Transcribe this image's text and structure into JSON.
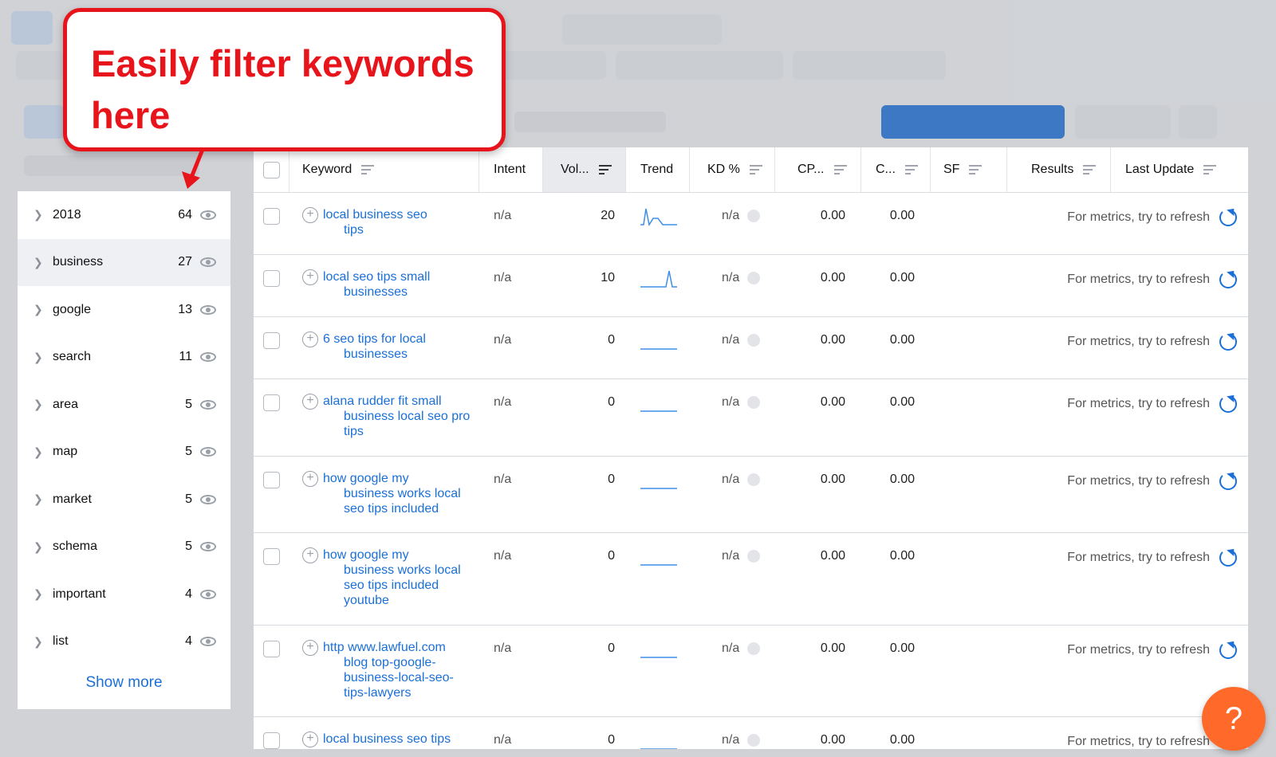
{
  "colors": {
    "accent": "#1a6fd8",
    "callout_red": "#e8141b",
    "help_orange": "#ff6a2b"
  },
  "callout": {
    "line1": "Easily filter keywords",
    "line2": "here"
  },
  "sidebar": {
    "items": [
      {
        "label": "2018",
        "count": "64"
      },
      {
        "label": "business",
        "count": "27",
        "active": true
      },
      {
        "label": "google",
        "count": "13"
      },
      {
        "label": "search",
        "count": "11"
      },
      {
        "label": "area",
        "count": "5"
      },
      {
        "label": "map",
        "count": "5"
      },
      {
        "label": "market",
        "count": "5"
      },
      {
        "label": "schema",
        "count": "5"
      },
      {
        "label": "important",
        "count": "4"
      },
      {
        "label": "list",
        "count": "4"
      }
    ],
    "show_more": "Show more"
  },
  "table": {
    "headers": {
      "keyword": "Keyword",
      "intent": "Intent",
      "volume": "Vol...",
      "trend": "Trend",
      "kd": "KD %",
      "cpc": "CP...",
      "com": "C...",
      "sf": "SF",
      "results": "Results",
      "last_update": "Last Update"
    },
    "rows": [
      {
        "keyword_lines": [
          "local business seo",
          "tips"
        ],
        "intent": "n/a",
        "volume": "20",
        "kd": "n/a",
        "cpc": "0.00",
        "com": "0.00",
        "last_update": "For metrics, try to refresh",
        "trend_shape": "spike-double"
      },
      {
        "keyword_lines": [
          "local seo tips small",
          "businesses"
        ],
        "intent": "n/a",
        "volume": "10",
        "kd": "n/a",
        "cpc": "0.00",
        "com": "0.00",
        "last_update": "For metrics, try to refresh",
        "trend_shape": "spike-single"
      },
      {
        "keyword_lines": [
          "6 seo tips for local",
          "businesses"
        ],
        "intent": "n/a",
        "volume": "0",
        "kd": "n/a",
        "cpc": "0.00",
        "com": "0.00",
        "last_update": "For metrics, try to refresh",
        "trend_shape": "flat"
      },
      {
        "keyword_lines": [
          "alana rudder fit small",
          "business local seo pro",
          "tips"
        ],
        "intent": "n/a",
        "volume": "0",
        "kd": "n/a",
        "cpc": "0.00",
        "com": "0.00",
        "last_update": "For metrics, try to refresh",
        "trend_shape": "flat"
      },
      {
        "keyword_lines": [
          "how google my",
          "business works local",
          "seo tips included"
        ],
        "intent": "n/a",
        "volume": "0",
        "kd": "n/a",
        "cpc": "0.00",
        "com": "0.00",
        "last_update": "For metrics, try to refresh",
        "trend_shape": "flat"
      },
      {
        "keyword_lines": [
          "how google my",
          "business works local",
          "seo tips included",
          "youtube"
        ],
        "intent": "n/a",
        "volume": "0",
        "kd": "n/a",
        "cpc": "0.00",
        "com": "0.00",
        "last_update": "For metrics, try to refresh",
        "trend_shape": "flat"
      },
      {
        "keyword_lines": [
          "http www.lawfuel.com",
          "blog top-google-",
          "business-local-seo-",
          "tips-lawyers"
        ],
        "intent": "n/a",
        "volume": "0",
        "kd": "n/a",
        "cpc": "0.00",
        "com": "0.00",
        "last_update": "For metrics, try to refresh",
        "trend_shape": "flat"
      },
      {
        "keyword_lines": [
          "local business seo tips"
        ],
        "intent": "n/a",
        "volume": "0",
        "kd": "n/a",
        "cpc": "0.00",
        "com": "0.00",
        "last_update": "For metrics, try to refresh",
        "trend_shape": "flat"
      }
    ]
  },
  "help": {
    "label": "?"
  }
}
